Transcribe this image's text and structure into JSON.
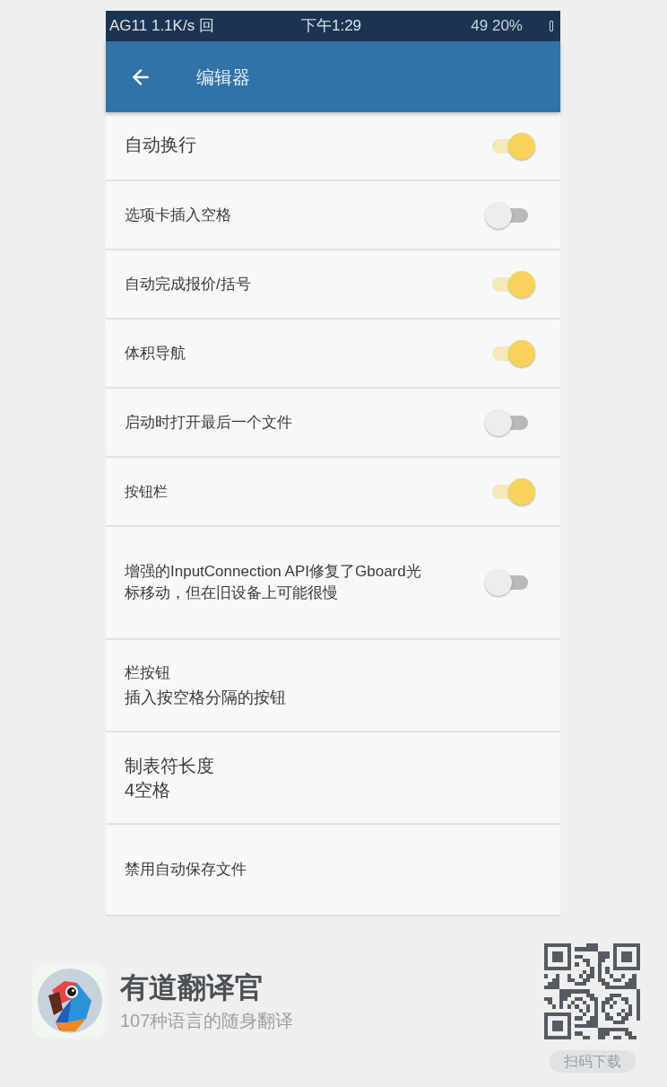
{
  "status_bar": {
    "left": "AG11 1.1K/s 回",
    "time": "下午1:29",
    "right": "49 20%"
  },
  "app_bar": {
    "title": "编辑器"
  },
  "settings": [
    {
      "kind": "switch",
      "title": "自动换行",
      "on": true
    },
    {
      "kind": "switch",
      "title": "选项卡插入空格",
      "on": false
    },
    {
      "kind": "switch",
      "title": "自动完成报价/括号",
      "on": true
    },
    {
      "kind": "switch",
      "title": "体积导航",
      "on": true
    },
    {
      "kind": "switch",
      "title": "启动时打开最后一个文件",
      "on": false
    },
    {
      "kind": "switch",
      "title": "按钮栏",
      "on": true
    },
    {
      "kind": "switch",
      "title": "增强的InputConnection API修复了Gboard光标移动，但在旧设备上可能很慢",
      "on": false
    },
    {
      "kind": "summary",
      "title": "栏按钮",
      "summary": "插入按空格分隔的按钮"
    },
    {
      "kind": "summary",
      "title": "制表符长度",
      "summary": "4空格"
    },
    {
      "kind": "plain",
      "title": "禁用自动保存文件"
    }
  ],
  "promo": {
    "app_name": "有道翻译官",
    "tagline": "107种语言的随身翻译",
    "button": "扫码下载"
  }
}
